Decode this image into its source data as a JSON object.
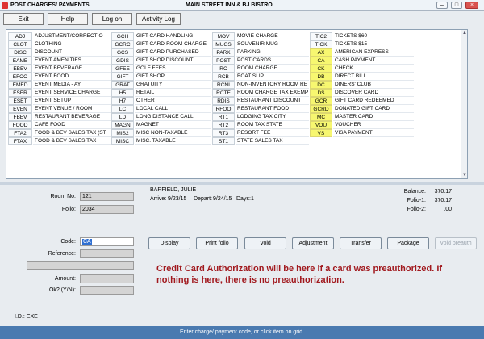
{
  "window": {
    "title": "POST CHARGES/ PAYMENTS",
    "center_title": "MAIN STREET INN & BJ BISTRO"
  },
  "toolbar": {
    "exit": "Exit",
    "help": "Help",
    "logon": "Log on",
    "activity": "Activity Log"
  },
  "grid": {
    "col1": [
      [
        "ADJ",
        "ADJUSTMENT/CORRECTIO"
      ],
      [
        "CLOT",
        "CLOTHING"
      ],
      [
        "DISC",
        "DISCOUNT"
      ],
      [
        "EAME",
        "EVENT AMENITIES"
      ],
      [
        "EBEV",
        "EVENT BEVERAGE"
      ],
      [
        "EFOO",
        "EVENT FOOD"
      ],
      [
        "EMED",
        "EVENT MEDIA - AY"
      ],
      [
        "ESER",
        "EVENT SERVICE CHARGE"
      ],
      [
        "ESET",
        "EVENT SETUP"
      ],
      [
        "EVEN",
        "EVENT VENUE / ROOM"
      ],
      [
        "FBEV",
        "RESTAURANT BEVERAGE"
      ],
      [
        "FOOD",
        "CAFE FOOD"
      ],
      [
        "FTA2",
        "FOOD & BEV SALES TAX (ST"
      ],
      [
        "FTAX",
        "FOOD & BEV SALES TAX"
      ]
    ],
    "col2": [
      [
        "GCH",
        "GIFT CARD HANDLING"
      ],
      [
        "GCRC",
        "GIFT CARD-ROOM CHARGE"
      ],
      [
        "GCS",
        "GIFT CARD PURCHASED"
      ],
      [
        "GDIS",
        "GIFT SHOP DISCOUNT"
      ],
      [
        "GFEE",
        "GOLF FEES"
      ],
      [
        "GIFT",
        "GIFT SHOP"
      ],
      [
        "GRAT",
        "GRATUITY"
      ],
      [
        "H5",
        "RETAIL"
      ],
      [
        "H7",
        "OTHER"
      ],
      [
        "LC",
        "LOCAL CALL"
      ],
      [
        "LD",
        "LONG DISTANCE CALL"
      ],
      [
        "MAGN",
        "MAGNET"
      ],
      [
        "MIS2",
        "MISC NON-TAXABLE"
      ],
      [
        "MISC",
        "MISC. TAXABLE"
      ]
    ],
    "col3": [
      [
        "MOV",
        "MOVIE CHARGE"
      ],
      [
        "MUGS",
        "SOUVENIR MUG"
      ],
      [
        "PARK",
        "PARKING"
      ],
      [
        "POST",
        "POST CARDS"
      ],
      [
        "RC",
        "ROOM CHARGE"
      ],
      [
        "RCB",
        "BOAT SLIP"
      ],
      [
        "RCNI",
        "NON-INVENTORY ROOM RE"
      ],
      [
        "RCTE",
        "ROOM CHARGE TAX EXEMP"
      ],
      [
        "RDIS",
        "RESTAURANT DISCOUNT"
      ],
      [
        "RFOO",
        "RESTAURANT FOOD"
      ],
      [
        "RT1",
        "LODGING TAX CITY"
      ],
      [
        "RT2",
        "ROOM TAX STATE"
      ],
      [
        "RT3",
        "RESORT FEE"
      ],
      [
        "ST1",
        "STATE SALES TAX"
      ]
    ],
    "col4": [
      [
        "TIC2",
        "TICKETS $60",
        false
      ],
      [
        "TICK",
        "TICKETS $15",
        false
      ],
      [
        "AX",
        "AMERICAN EXPRESS",
        true
      ],
      [
        "CA",
        "CASH PAYMENT",
        true
      ],
      [
        "CK",
        "CHECK",
        true
      ],
      [
        "DB",
        "DIRECT BILL",
        true
      ],
      [
        "DC",
        "DINERS' CLUB",
        true
      ],
      [
        "DS",
        "DISCOVER CARD",
        true
      ],
      [
        "GCR",
        "GIFT CARD REDEEMED",
        true
      ],
      [
        "GCRD",
        "DONATED GIFT CARD",
        true
      ],
      [
        "MC",
        "MASTER CARD",
        true
      ],
      [
        "VOU",
        "VOUCHER",
        true
      ],
      [
        "VS",
        "VISA PAYMENT",
        true
      ]
    ]
  },
  "form": {
    "room_label": "Room No:",
    "room_value": "121",
    "folio_label": "Folio:",
    "folio_value": "2034",
    "code_label": "Code:",
    "code_value": "CA",
    "reference_label": "Reference:",
    "amount_label": "Amount:",
    "ok_label": "Ok? (Y/N):",
    "id_label": "I.D.: EXE"
  },
  "guest": {
    "name": "BARFIELD, JULIE",
    "arrive_label": "Arrive:",
    "arrive": "9/23/15",
    "depart_label": "Depart:",
    "depart": "9/24/15",
    "days_label": "Days:",
    "days": "1",
    "balance_label": "Balance:",
    "balance": "370.17",
    "folio1_label": "Folio-1:",
    "folio1": "370.17",
    "folio2_label": "Folio-2:",
    "folio2": ".00"
  },
  "actions": {
    "display": "Display",
    "print": "Print folio",
    "void": "Void",
    "adjustment": "Adjustment",
    "transfer": "Transfer",
    "package": "Package",
    "void_preauth": "Void preauth"
  },
  "notice": "Credit Card Authorization will be here if a card was  preauthorized.  If nothing is here, there is no preauthorization.",
  "status": "Enter charge/ payment code, or click item on grid.",
  "colors": {
    "highlight": "#f7f770",
    "status_bar": "#4a7ab0",
    "notice": "#a1191e"
  }
}
